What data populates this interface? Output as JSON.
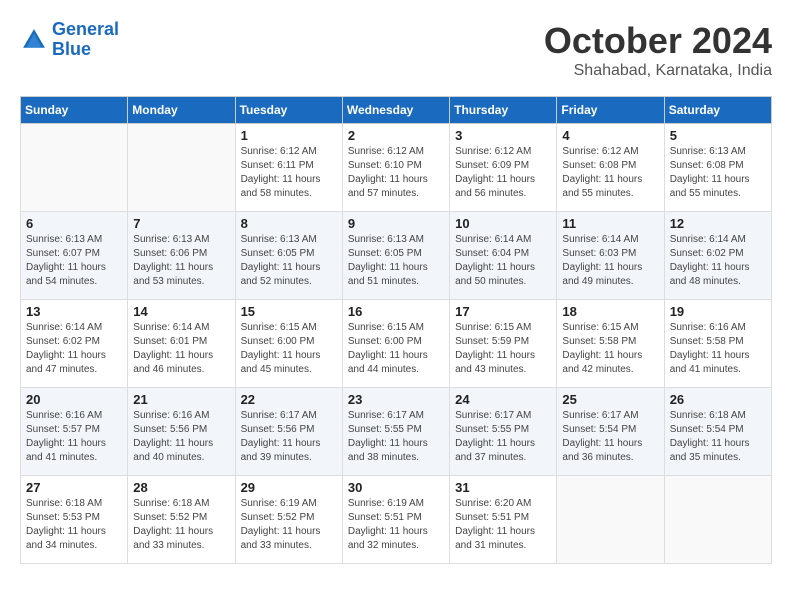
{
  "header": {
    "logo_line1": "General",
    "logo_line2": "Blue",
    "month": "October 2024",
    "location": "Shahabad, Karnataka, India"
  },
  "weekdays": [
    "Sunday",
    "Monday",
    "Tuesday",
    "Wednesday",
    "Thursday",
    "Friday",
    "Saturday"
  ],
  "weeks": [
    [
      {
        "day": "",
        "info": ""
      },
      {
        "day": "",
        "info": ""
      },
      {
        "day": "1",
        "info": "Sunrise: 6:12 AM\nSunset: 6:11 PM\nDaylight: 11 hours\nand 58 minutes."
      },
      {
        "day": "2",
        "info": "Sunrise: 6:12 AM\nSunset: 6:10 PM\nDaylight: 11 hours\nand 57 minutes."
      },
      {
        "day": "3",
        "info": "Sunrise: 6:12 AM\nSunset: 6:09 PM\nDaylight: 11 hours\nand 56 minutes."
      },
      {
        "day": "4",
        "info": "Sunrise: 6:12 AM\nSunset: 6:08 PM\nDaylight: 11 hours\nand 55 minutes."
      },
      {
        "day": "5",
        "info": "Sunrise: 6:13 AM\nSunset: 6:08 PM\nDaylight: 11 hours\nand 55 minutes."
      }
    ],
    [
      {
        "day": "6",
        "info": "Sunrise: 6:13 AM\nSunset: 6:07 PM\nDaylight: 11 hours\nand 54 minutes."
      },
      {
        "day": "7",
        "info": "Sunrise: 6:13 AM\nSunset: 6:06 PM\nDaylight: 11 hours\nand 53 minutes."
      },
      {
        "day": "8",
        "info": "Sunrise: 6:13 AM\nSunset: 6:05 PM\nDaylight: 11 hours\nand 52 minutes."
      },
      {
        "day": "9",
        "info": "Sunrise: 6:13 AM\nSunset: 6:05 PM\nDaylight: 11 hours\nand 51 minutes."
      },
      {
        "day": "10",
        "info": "Sunrise: 6:14 AM\nSunset: 6:04 PM\nDaylight: 11 hours\nand 50 minutes."
      },
      {
        "day": "11",
        "info": "Sunrise: 6:14 AM\nSunset: 6:03 PM\nDaylight: 11 hours\nand 49 minutes."
      },
      {
        "day": "12",
        "info": "Sunrise: 6:14 AM\nSunset: 6:02 PM\nDaylight: 11 hours\nand 48 minutes."
      }
    ],
    [
      {
        "day": "13",
        "info": "Sunrise: 6:14 AM\nSunset: 6:02 PM\nDaylight: 11 hours\nand 47 minutes."
      },
      {
        "day": "14",
        "info": "Sunrise: 6:14 AM\nSunset: 6:01 PM\nDaylight: 11 hours\nand 46 minutes."
      },
      {
        "day": "15",
        "info": "Sunrise: 6:15 AM\nSunset: 6:00 PM\nDaylight: 11 hours\nand 45 minutes."
      },
      {
        "day": "16",
        "info": "Sunrise: 6:15 AM\nSunset: 6:00 PM\nDaylight: 11 hours\nand 44 minutes."
      },
      {
        "day": "17",
        "info": "Sunrise: 6:15 AM\nSunset: 5:59 PM\nDaylight: 11 hours\nand 43 minutes."
      },
      {
        "day": "18",
        "info": "Sunrise: 6:15 AM\nSunset: 5:58 PM\nDaylight: 11 hours\nand 42 minutes."
      },
      {
        "day": "19",
        "info": "Sunrise: 6:16 AM\nSunset: 5:58 PM\nDaylight: 11 hours\nand 41 minutes."
      }
    ],
    [
      {
        "day": "20",
        "info": "Sunrise: 6:16 AM\nSunset: 5:57 PM\nDaylight: 11 hours\nand 41 minutes."
      },
      {
        "day": "21",
        "info": "Sunrise: 6:16 AM\nSunset: 5:56 PM\nDaylight: 11 hours\nand 40 minutes."
      },
      {
        "day": "22",
        "info": "Sunrise: 6:17 AM\nSunset: 5:56 PM\nDaylight: 11 hours\nand 39 minutes."
      },
      {
        "day": "23",
        "info": "Sunrise: 6:17 AM\nSunset: 5:55 PM\nDaylight: 11 hours\nand 38 minutes."
      },
      {
        "day": "24",
        "info": "Sunrise: 6:17 AM\nSunset: 5:55 PM\nDaylight: 11 hours\nand 37 minutes."
      },
      {
        "day": "25",
        "info": "Sunrise: 6:17 AM\nSunset: 5:54 PM\nDaylight: 11 hours\nand 36 minutes."
      },
      {
        "day": "26",
        "info": "Sunrise: 6:18 AM\nSunset: 5:54 PM\nDaylight: 11 hours\nand 35 minutes."
      }
    ],
    [
      {
        "day": "27",
        "info": "Sunrise: 6:18 AM\nSunset: 5:53 PM\nDaylight: 11 hours\nand 34 minutes."
      },
      {
        "day": "28",
        "info": "Sunrise: 6:18 AM\nSunset: 5:52 PM\nDaylight: 11 hours\nand 33 minutes."
      },
      {
        "day": "29",
        "info": "Sunrise: 6:19 AM\nSunset: 5:52 PM\nDaylight: 11 hours\nand 33 minutes."
      },
      {
        "day": "30",
        "info": "Sunrise: 6:19 AM\nSunset: 5:51 PM\nDaylight: 11 hours\nand 32 minutes."
      },
      {
        "day": "31",
        "info": "Sunrise: 6:20 AM\nSunset: 5:51 PM\nDaylight: 11 hours\nand 31 minutes."
      },
      {
        "day": "",
        "info": ""
      },
      {
        "day": "",
        "info": ""
      }
    ]
  ]
}
